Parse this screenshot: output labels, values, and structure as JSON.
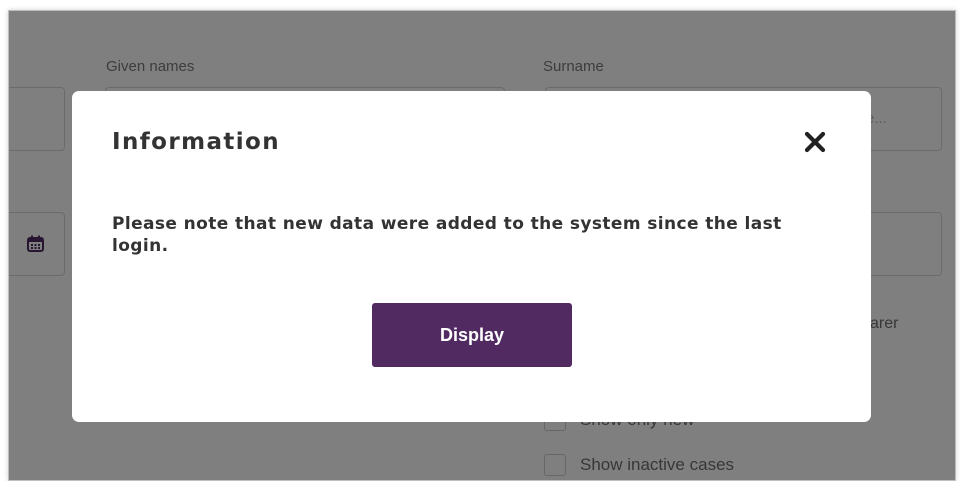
{
  "form": {
    "given_names_label": "Given names",
    "surname_label": "Surname",
    "surname_placeholder_tail": "e...",
    "bearer_text_tail": "arer",
    "show_only_new_label": "Show only new",
    "show_inactive_label": "Show inactive cases"
  },
  "modal": {
    "title": "Information",
    "close_icon": "close-x-icon",
    "message": "Please note that new data were added to the system since the last login.",
    "display_label": "Display"
  },
  "colors": {
    "primary_button": "#512a62",
    "overlay": "rgba(0,0,0,0.5)",
    "calendar_icon": "#512a62"
  }
}
